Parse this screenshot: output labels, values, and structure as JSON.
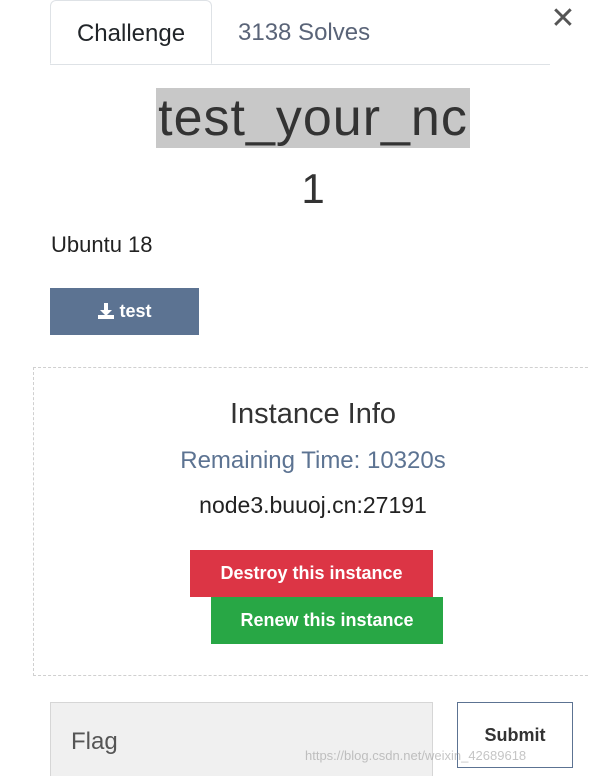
{
  "tabs": [
    {
      "label": "Challenge"
    },
    {
      "label": "3138 Solves"
    }
  ],
  "close_icon": "close-icon",
  "challenge": {
    "name": "test_your_nc",
    "value": "1",
    "description": "Ubuntu 18",
    "file_button_label": "test",
    "file_icon": "download-icon"
  },
  "instance": {
    "title": "Instance Info",
    "remaining": "Remaining Time: 10320s",
    "host": "node3.buuoj.cn:27191",
    "destroy_label": "Destroy this instance",
    "renew_label": "Renew this instance"
  },
  "flag": {
    "placeholder": "Flag",
    "submit_label": "Submit"
  },
  "watermark": "https://blog.csdn.net/weixin_42689618",
  "colors": {
    "file_button": "#5c7392",
    "destroy": "#dc3545",
    "renew": "#28a745",
    "title_highlight": "#c8c8c8"
  }
}
